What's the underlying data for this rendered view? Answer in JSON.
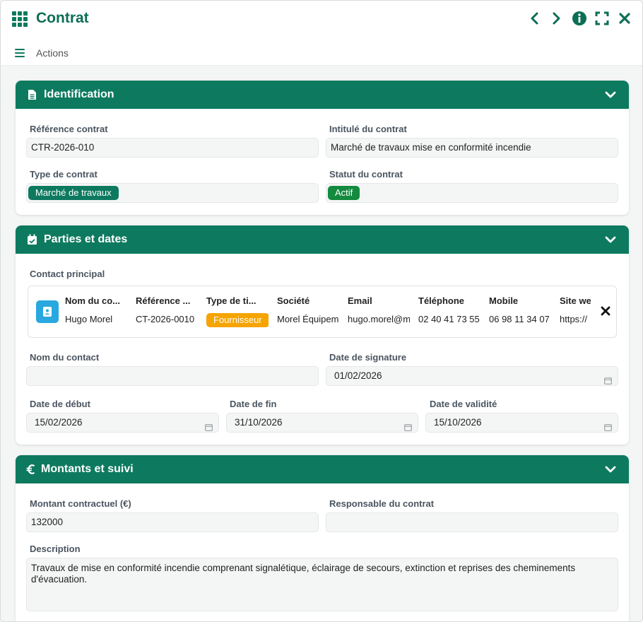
{
  "window": {
    "title": "Contrat"
  },
  "toolbar": {
    "actions_label": "Actions"
  },
  "identification": {
    "title": "Identification",
    "reference_label": "Référence contrat",
    "reference_value": "CTR-2026-010",
    "intitule_label": "Intitulé du contrat",
    "intitule_value": "Marché de travaux mise en conformité incendie",
    "type_label": "Type de contrat",
    "type_value": "Marché de travaux",
    "statut_label": "Statut du contrat",
    "statut_value": "Actif"
  },
  "parties": {
    "title": "Parties et dates",
    "contact_principal_label": "Contact principal",
    "contact_headers": [
      "Nom du co...",
      "Référence ...",
      "Type de ti...",
      "Société",
      "Email",
      "Téléphone",
      "Mobile",
      "Site we"
    ],
    "contact_values": [
      "Hugo Morel",
      "CT-2026-0010",
      "Fournisseur",
      "Morel Équipements",
      "hugo.morel@m",
      "02 40 41 73 55",
      "06 98 11 34 07",
      "https://"
    ],
    "nom_contact_label": "Nom du contact",
    "nom_contact_value": "",
    "date_signature_label": "Date de signature",
    "date_signature_value": "01/02/2026",
    "date_debut_label": "Date de début",
    "date_debut_value": "15/02/2026",
    "date_fin_label": "Date de fin",
    "date_fin_value": "31/10/2026",
    "date_validite_label": "Date de validité",
    "date_validite_value": "15/10/2026"
  },
  "montants": {
    "title": "Montants et suivi",
    "montant_label": "Montant contractuel (€)",
    "montant_value": "132000",
    "responsable_label": "Responsable du contrat",
    "responsable_value": "",
    "description_label": "Description",
    "description_value": "Travaux de mise en conformité incendie comprenant signalétique, éclairage de secours, extinction et reprises des cheminements d'évacuation."
  },
  "colors": {
    "primary": "#0d7a5f",
    "badge_type": "#0d7a5f",
    "badge_statut": "#138a3e",
    "badge_fournisseur": "#f5a400",
    "avatar": "#29a8e0"
  },
  "icons": {
    "app": "grid-icon",
    "prev": "chevron-left-icon",
    "next": "chevron-right-icon",
    "info": "info-icon",
    "expand": "fullscreen-icon",
    "close": "close-icon",
    "menu": "hamburger-icon",
    "identification": "document-icon",
    "parties": "calendar-check-icon",
    "montants": "euro-icon",
    "collapse": "chevron-down-icon",
    "calendar": "calendar-icon",
    "contact": "contact-card-icon",
    "remove": "close-icon"
  }
}
